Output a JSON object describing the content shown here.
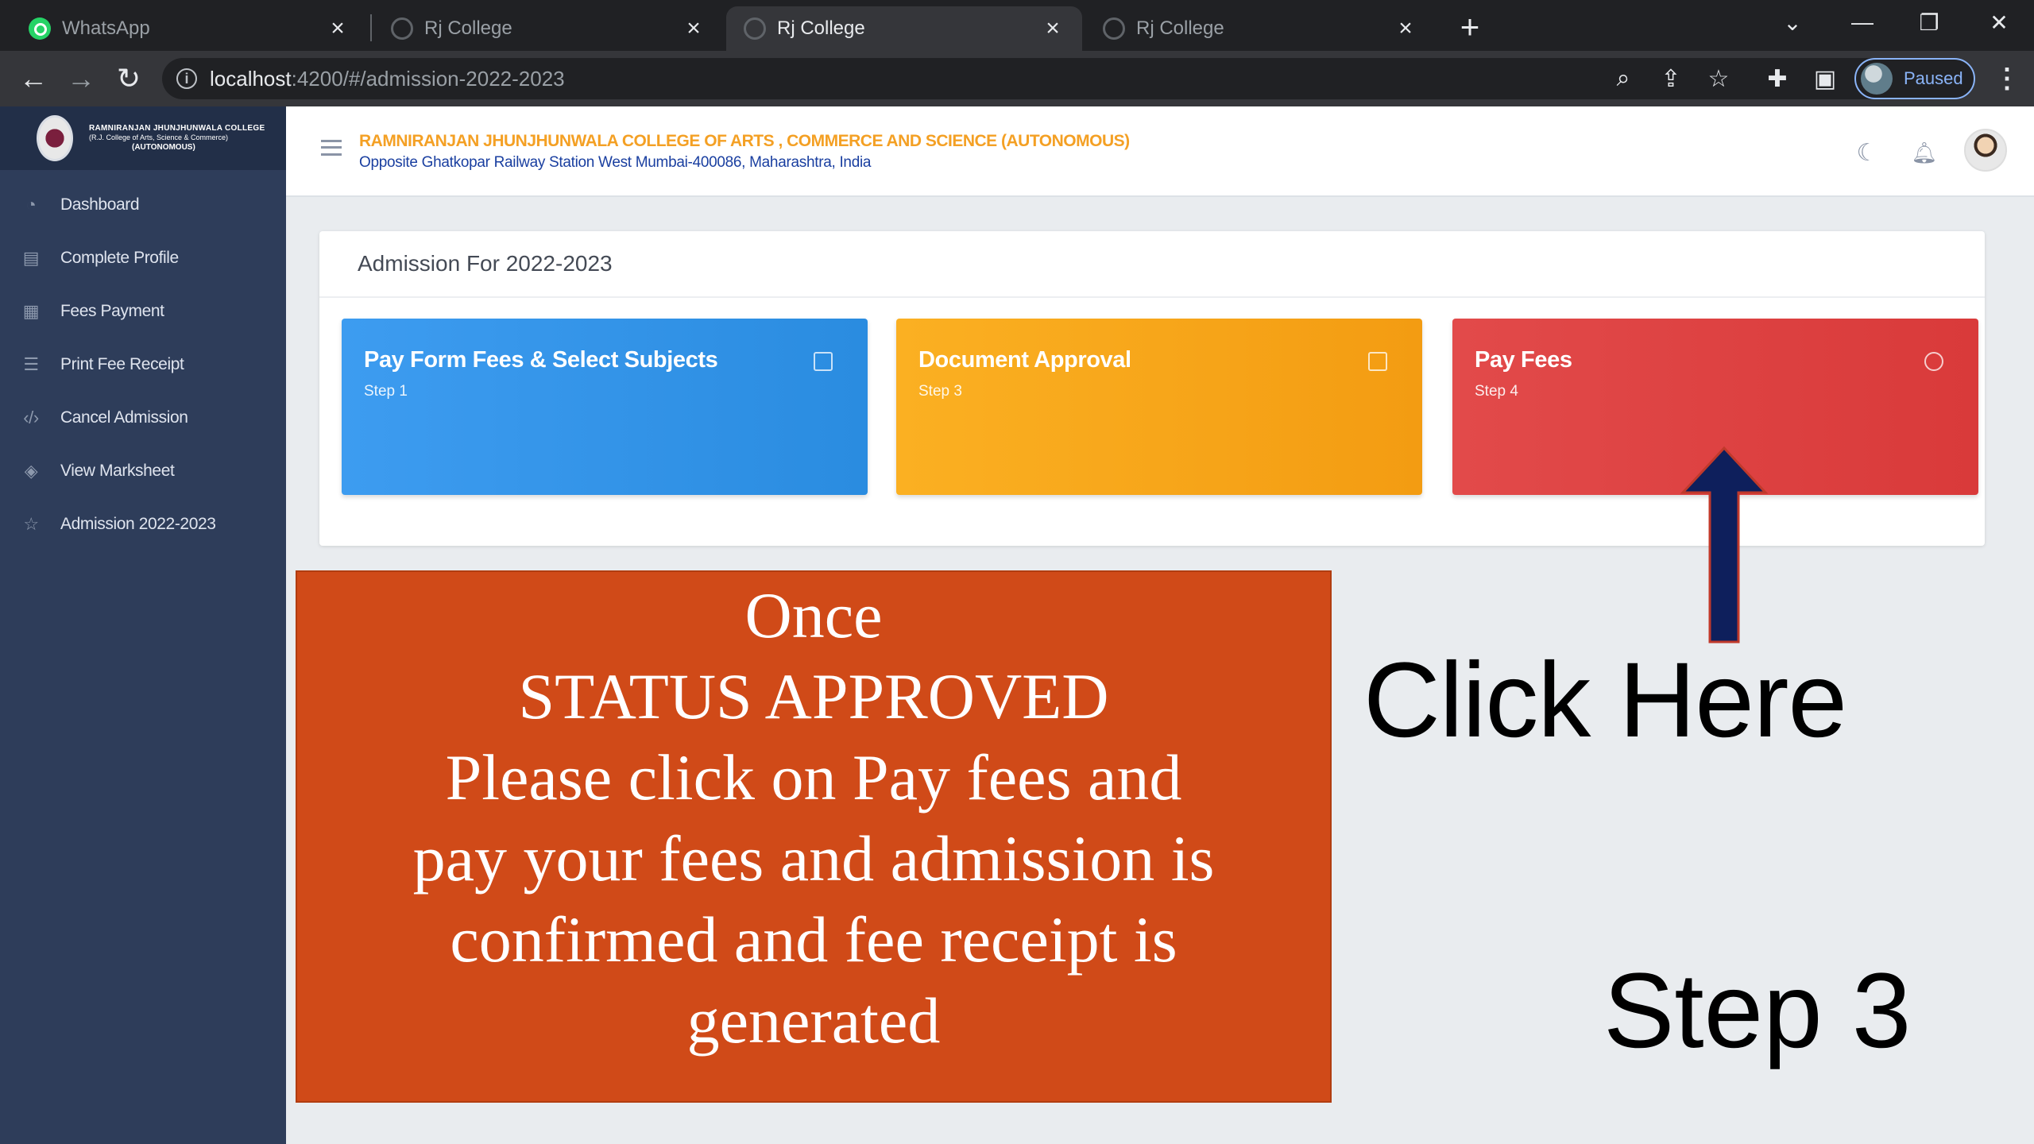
{
  "browser": {
    "tabs": [
      {
        "title": "WhatsApp",
        "favicon": "whatsapp-icon",
        "active": false
      },
      {
        "title": "Rj College",
        "favicon": "globe-icon",
        "active": false
      },
      {
        "title": "Rj College",
        "favicon": "globe-icon",
        "active": true
      },
      {
        "title": "Rj College",
        "favicon": "globe-icon",
        "active": false
      }
    ],
    "address": {
      "host": "localhost",
      "rest": ":4200/#/admission-2022-2023"
    },
    "profile_label": "Paused"
  },
  "sidebar": {
    "brand": {
      "line1": "RAMNIRANJAN JHUNJHUNWALA COLLEGE",
      "line2": "(R.J. College of Arts, Science & Commerce)",
      "line3": "(AUTONOMOUS)"
    },
    "items": [
      {
        "label": "Dashboard",
        "icon": "gauge-icon"
      },
      {
        "label": "Complete Profile",
        "icon": "document-icon"
      },
      {
        "label": "Fees Payment",
        "icon": "table-icon"
      },
      {
        "label": "Print Fee Receipt",
        "icon": "list-icon"
      },
      {
        "label": "Cancel Admission",
        "icon": "code-icon"
      },
      {
        "label": "View Marksheet",
        "icon": "layers-icon"
      },
      {
        "label": "Admission 2022-2023",
        "icon": "star-icon"
      }
    ]
  },
  "header": {
    "college_name": "RAMNIRANJAN JHUNJHUNWALA COLLEGE OF ARTS , COMMERCE AND SCIENCE (AUTONOMOUS)",
    "address": "Opposite Ghatkopar Railway Station West Mumbai-400086, Maharashtra, India"
  },
  "admission": {
    "title": "Admission For 2022-2023",
    "cards": [
      {
        "title": "Pay Form Fees & Select Subjects",
        "step": "Step 1",
        "color": "#3498e8"
      },
      {
        "title": "Document Approval",
        "step": "Step 3",
        "color": "#f6a418"
      },
      {
        "title": "Pay Fees",
        "step": "Step 4",
        "color": "#de4343"
      }
    ]
  },
  "tutorial": {
    "callout_lines": [
      "Once",
      "STATUS APPROVED",
      "Please click on Pay fees and",
      "pay your fees and admission is",
      "confirmed and fee receipt is",
      "generated"
    ],
    "click_here": "Click Here",
    "step": "Step 3",
    "callout_color": "#d04a18",
    "arrow_color": "#0e1f5c"
  }
}
